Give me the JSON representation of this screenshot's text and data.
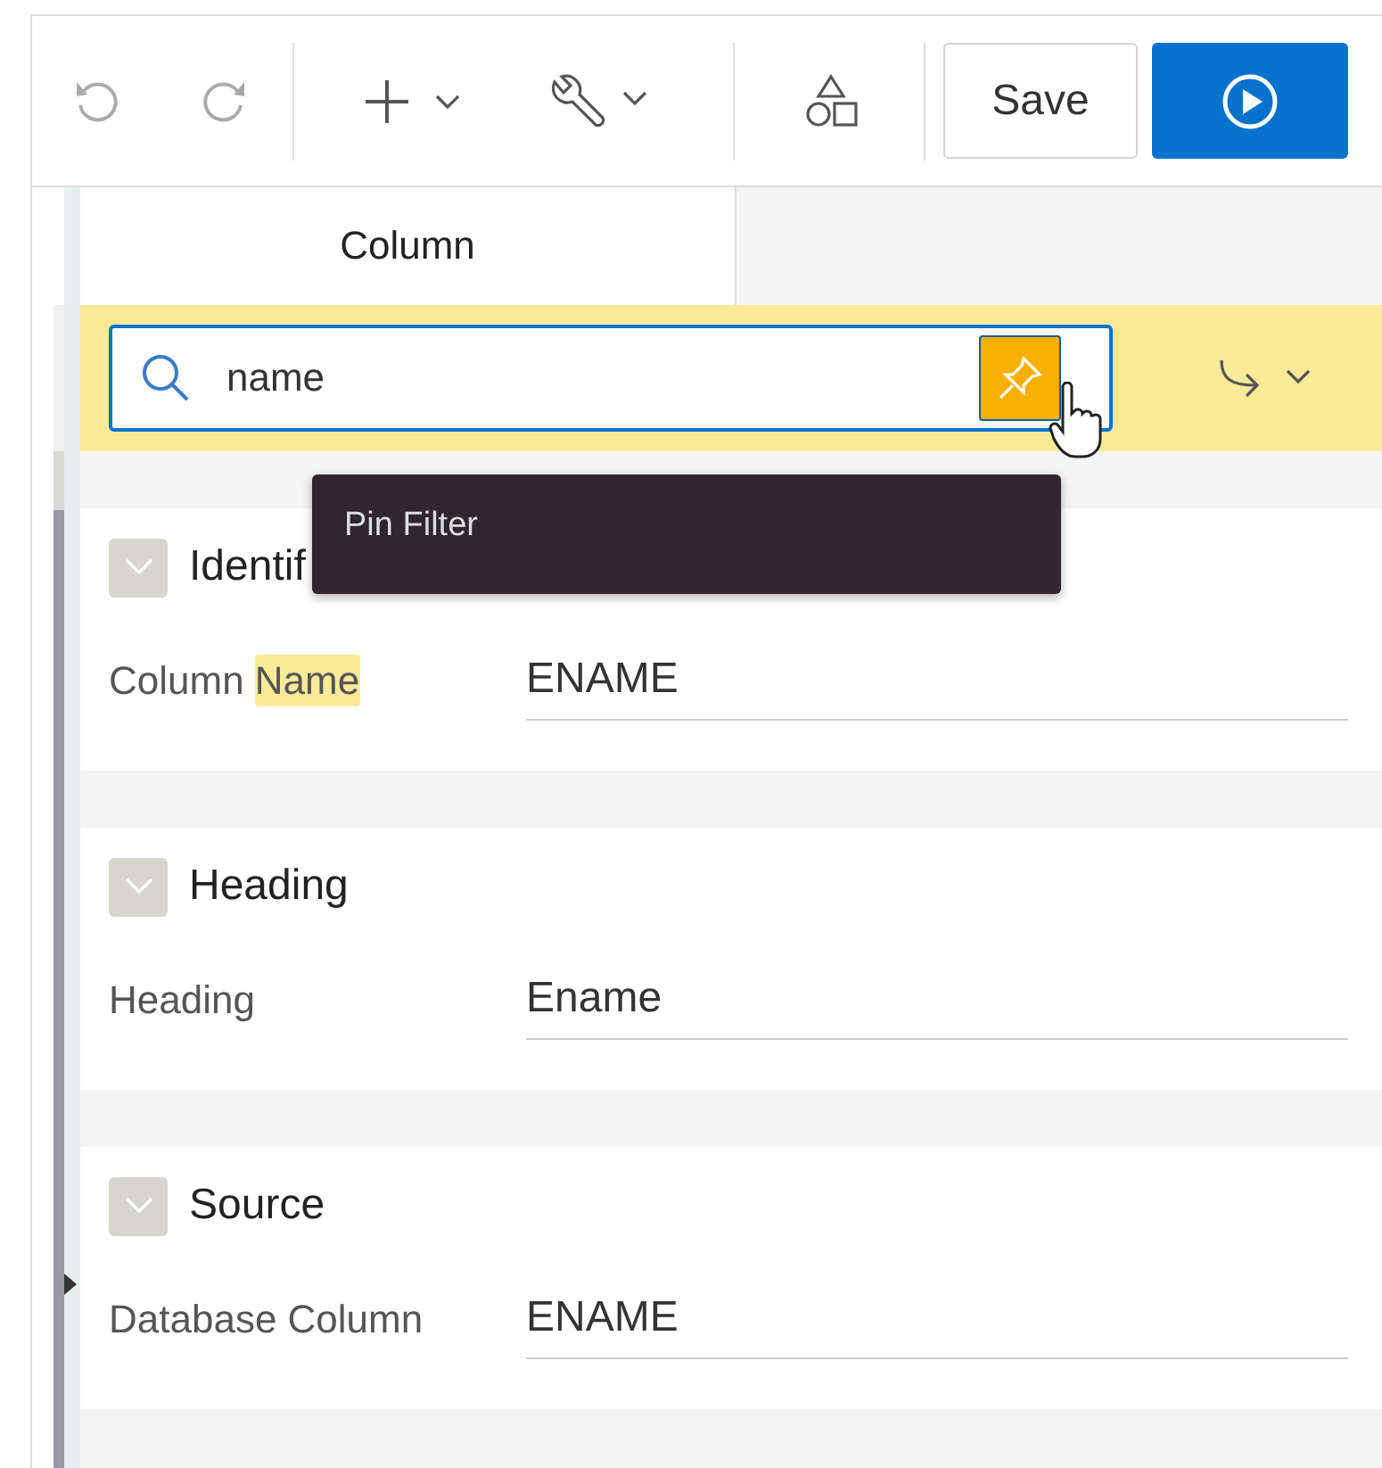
{
  "toolbar": {
    "save_label": "Save"
  },
  "tabs": [
    {
      "label": "Column",
      "selected": true
    }
  ],
  "filter": {
    "value": "name",
    "pinned": true
  },
  "tooltip": {
    "text": "Pin Filter"
  },
  "sections": [
    {
      "title": "Identif",
      "expanded": true,
      "fields": [
        {
          "label": "Column ",
          "match": "Name",
          "value": "ENAME"
        }
      ]
    },
    {
      "title": "Heading",
      "expanded": true,
      "fields": [
        {
          "label": "Heading",
          "value": "Ename"
        }
      ]
    },
    {
      "title": "Source",
      "expanded": true,
      "fields": [
        {
          "label": "Database Column",
          "value": "ENAME"
        }
      ]
    }
  ]
}
